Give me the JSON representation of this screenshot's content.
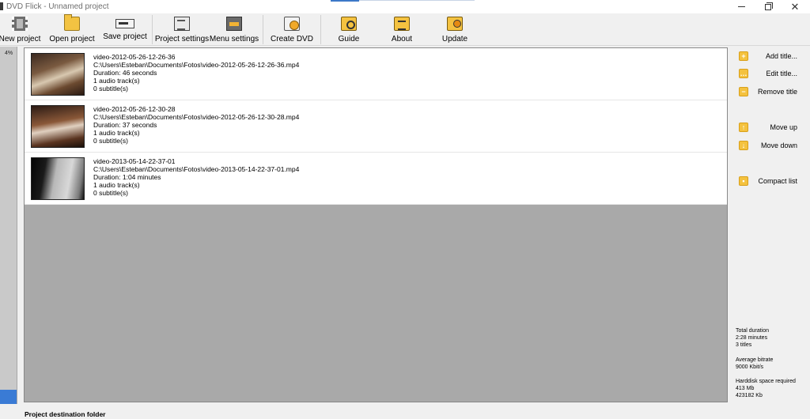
{
  "window": {
    "title": "DVD Flick - Unnamed project"
  },
  "toolbar": {
    "buttons": [
      {
        "label": "New project",
        "icon": "film-icon"
      },
      {
        "label": "Open project",
        "icon": "folder-icon"
      },
      {
        "label": "Save project",
        "icon": "save-icon"
      },
      {
        "label": "Project settings",
        "icon": "settings-icon"
      },
      {
        "label": "Menu settings",
        "icon": "menu-icon"
      },
      {
        "label": "Create DVD",
        "icon": "dvd-icon"
      },
      {
        "label": "Guide",
        "icon": "guide-icon"
      },
      {
        "label": "About",
        "icon": "about-icon"
      },
      {
        "label": "Update",
        "icon": "update-icon"
      }
    ]
  },
  "capacity": {
    "label": "4%",
    "fill_fraction": 0.04,
    "color": "#3a7bd5"
  },
  "titles": [
    {
      "name": "video-2012-05-26-12-26-36",
      "path": "C:\\Users\\Esteban\\Documents\\Fotos\\video-2012-05-26-12-26-36.mp4",
      "duration": "Duration: 46 seconds",
      "audio": "1 audio track(s)",
      "subtitles": "0 subtitle(s)"
    },
    {
      "name": "video-2012-05-26-12-30-28",
      "path": "C:\\Users\\Esteban\\Documents\\Fotos\\video-2012-05-26-12-30-28.mp4",
      "duration": "Duration: 37 seconds",
      "audio": "1 audio track(s)",
      "subtitles": "0 subtitle(s)"
    },
    {
      "name": "video-2013-05-14-22-37-01",
      "path": "C:\\Users\\Esteban\\Documents\\Fotos\\video-2013-05-14-22-37-01.mp4",
      "duration": "Duration: 1:04 minutes",
      "audio": "1 audio track(s)",
      "subtitles": "0 subtitle(s)"
    }
  ],
  "side_panel": {
    "add_title": "Add title...",
    "edit_title": "Edit title...",
    "remove_title": "Remove title",
    "move_up": "Move up",
    "move_down": "Move down",
    "compact_list": "Compact list",
    "accent": "#f4c23f"
  },
  "stats": {
    "total_duration_label": "Total duration",
    "total_duration_value": "2:28 minutes",
    "titles_count": "3 titles",
    "bitrate_label": "Average bitrate",
    "bitrate_value": "9000 Kbit/s",
    "disk_label": "Harddisk space required",
    "disk_mb": "413 Mb",
    "disk_kb": "423182 Kb"
  },
  "footer": {
    "destination_label": "Project destination folder"
  }
}
